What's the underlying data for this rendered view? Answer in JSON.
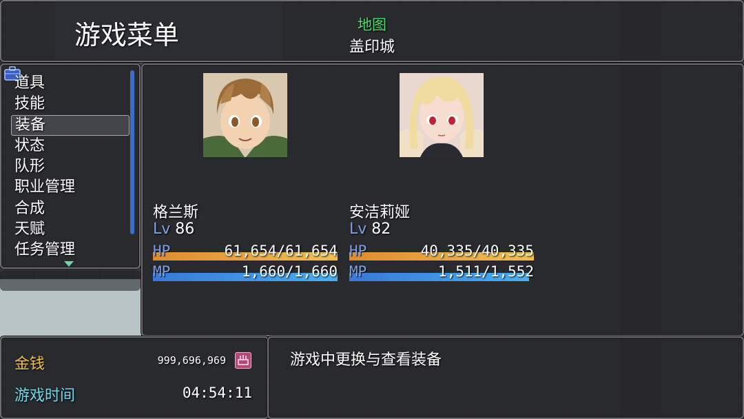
{
  "header": {
    "menu_title": "游戏菜单",
    "map_label": "地图",
    "map_name": "盖印城"
  },
  "commands": [
    {
      "label": "道具",
      "selected": false
    },
    {
      "label": "技能",
      "selected": false
    },
    {
      "label": "装备",
      "selected": true
    },
    {
      "label": "状态",
      "selected": false
    },
    {
      "label": "队形",
      "selected": false
    },
    {
      "label": "职业管理",
      "selected": false
    },
    {
      "label": "合成",
      "selected": false
    },
    {
      "label": "天赋",
      "selected": false
    },
    {
      "label": "任务管理",
      "selected": false
    }
  ],
  "actors": [
    {
      "name": "格兰斯",
      "lv_label": "Lv",
      "level": "86",
      "hp_label": "HP",
      "hp": "61,654/61,654",
      "hp_ratio": 1.0,
      "mp_label": "MP",
      "mp": "1,660/1,660",
      "mp_ratio": 1.0,
      "portrait_icon": "brown-haired-boy-portrait"
    },
    {
      "name": "安洁莉娅",
      "lv_label": "Lv",
      "level": "82",
      "hp_label": "HP",
      "hp": "40,335/40,335",
      "hp_ratio": 1.0,
      "mp_label": "MP",
      "mp": "1,511/1,552",
      "mp_ratio": 0.974,
      "portrait_icon": "blonde-girl-portrait"
    }
  ],
  "footer": {
    "gold_label": "金钱",
    "gold_value": "999,696,969",
    "time_label": "游戏时间",
    "time_value": "04:54:11",
    "description": "游戏中更换与查看装备"
  },
  "colors": {
    "map_label": "#50d870",
    "gold_label": "#f0c040",
    "time_label": "#70d8e8",
    "system_blue": "#7da0e8",
    "hp_gauge": "#f0a040",
    "mp_gauge": "#40a0e8"
  }
}
